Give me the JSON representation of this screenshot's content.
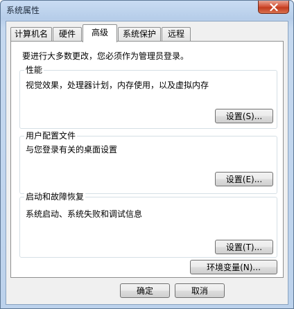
{
  "window": {
    "title": "系统属性",
    "close_icon": "close-x-icon"
  },
  "tabs": [
    {
      "label": "计算机名",
      "active": false
    },
    {
      "label": "硬件",
      "active": false
    },
    {
      "label": "高级",
      "active": true
    },
    {
      "label": "系统保护",
      "active": false
    },
    {
      "label": "远程",
      "active": false
    }
  ],
  "notice": "要进行大多数更改，您必须作为管理员登录。",
  "performance": {
    "title": "性能",
    "description": "视觉效果，处理器计划，内存使用，以及虚拟内存",
    "button": "设置(S)..."
  },
  "user_profiles": {
    "title": "用户配置文件",
    "description": "与您登录有关的桌面设置",
    "button": "设置(E)..."
  },
  "startup_recovery": {
    "title": "启动和故障恢复",
    "description": "系统启动、系统失败和调试信息",
    "button": "设置(T)..."
  },
  "env_button": "环境变量(N)...",
  "footer": {
    "ok": "确定",
    "cancel": "取消"
  },
  "colors": {
    "title_bar": "#b9d1ea",
    "close_button": "#c94a2f",
    "panel_bg": "#ffffff",
    "dialog_bg": "#f0f0f0"
  }
}
